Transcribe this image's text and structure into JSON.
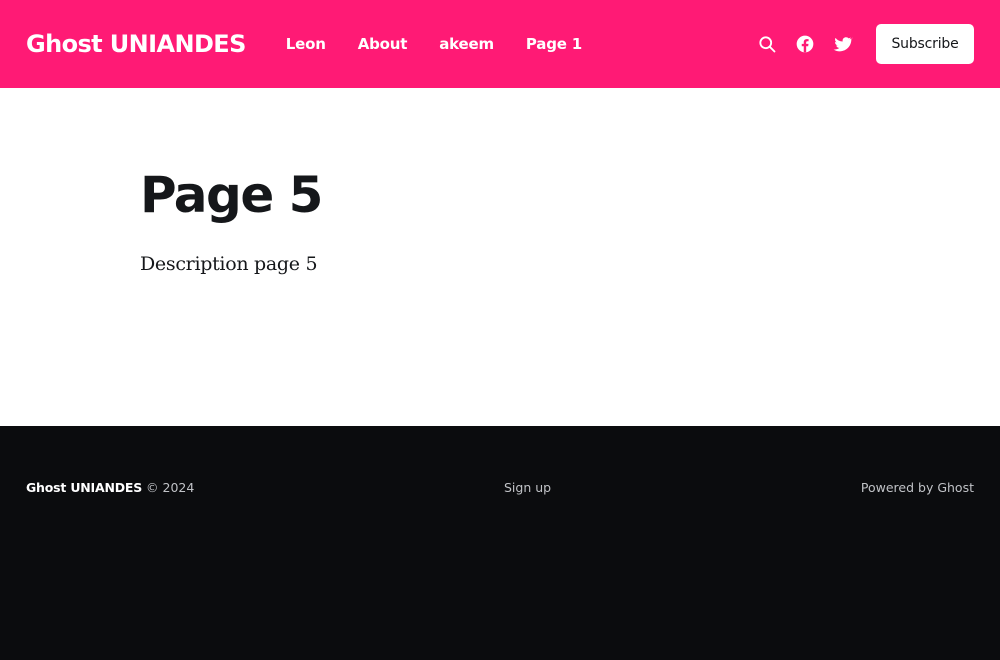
{
  "colors": {
    "accent": "#ff1a75",
    "footer_bg": "#0b0c0e",
    "text_dark": "#15171a"
  },
  "header": {
    "site_title": "Ghost UNIANDES",
    "nav": [
      "Leon",
      "About",
      "akeem",
      "Page 1"
    ],
    "icons": [
      "search-icon",
      "facebook-icon",
      "twitter-icon"
    ],
    "subscribe_label": "Subscribe"
  },
  "main": {
    "title": "Page 5",
    "description": "Description page 5"
  },
  "footer": {
    "brand": "Ghost UNIANDES",
    "copyright": "© 2024",
    "signup": "Sign up",
    "powered": "Powered by Ghost"
  }
}
